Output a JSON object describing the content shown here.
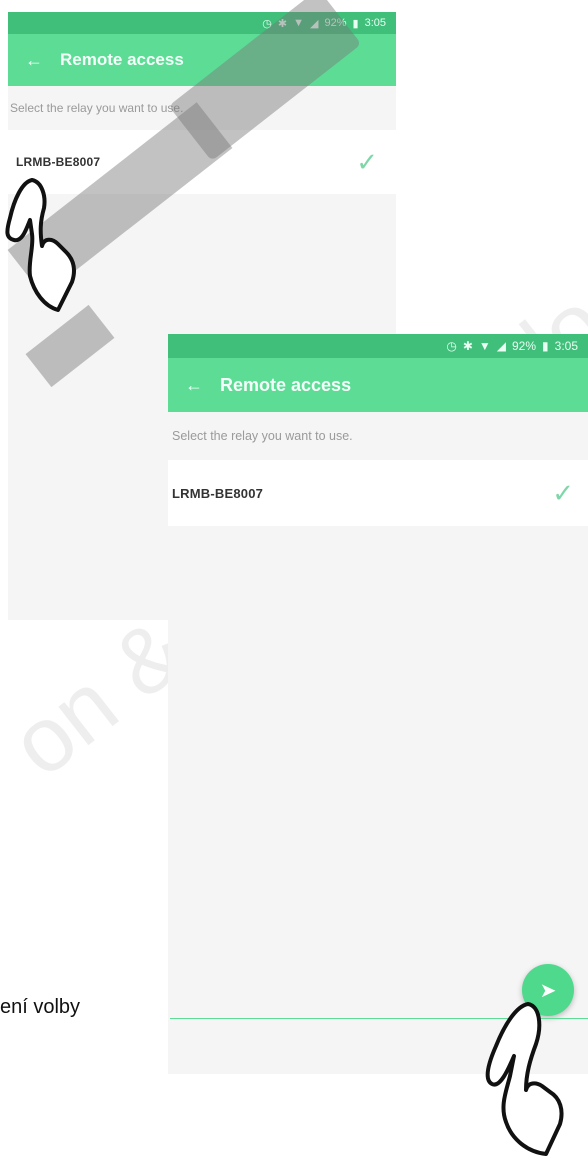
{
  "back_screen": {
    "status_text": "92%",
    "time": "3:05",
    "title": "Remote access",
    "hint": "Select the relay you want to use.",
    "relay_name": "LRMB-BE8007"
  },
  "front_screen": {
    "status_text": "92%",
    "time": "3:05",
    "title": "Remote access",
    "hint": "Select the relay you want to use.",
    "relay_name": "LRMB-BE8007"
  },
  "caption": "ení volby",
  "watermark": "on & turf technologies",
  "colors": {
    "status_bar": "#3fbf7a",
    "app_bar": "#5ddc96",
    "fab": "#4fd98c",
    "check": "#7fd7a9"
  },
  "icons": [
    "back-arrow-icon",
    "checkmark-icon",
    "send-icon",
    "hand-pointer-icon",
    "alarm-icon",
    "bluetooth-icon",
    "wifi-icon",
    "signal-icon",
    "battery-icon"
  ]
}
